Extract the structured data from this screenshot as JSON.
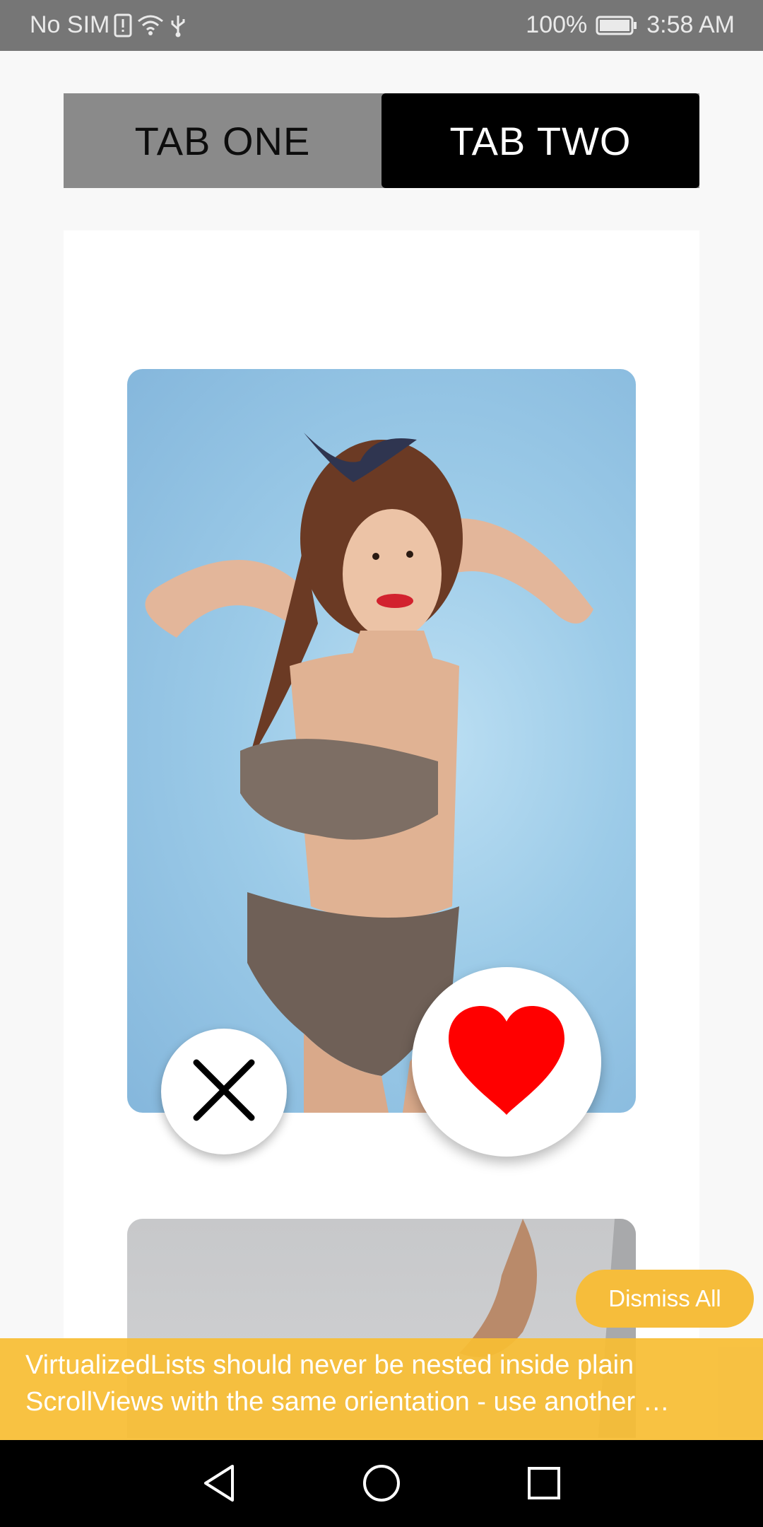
{
  "status_bar": {
    "carrier": "No SIM",
    "battery": "100%",
    "time": "3:58 AM",
    "icons": [
      "sim-alert-icon",
      "wifi-icon",
      "usb-icon",
      "battery-icon"
    ]
  },
  "tabs": [
    {
      "label": "TAB ONE",
      "selected": false
    },
    {
      "label": "TAB TWO",
      "selected": true
    }
  ],
  "card": {
    "dislike_icon": "close-icon",
    "like_icon": "heart-icon",
    "like_color": "#ff0000"
  },
  "warning": {
    "dismiss_label": "Dismiss All",
    "line1": "VirtualizedLists should never be nested inside plain",
    "line2": "ScrollViews with the same orientation - use another …"
  },
  "nav_bar": {
    "icons": [
      "back-icon",
      "home-icon",
      "recents-icon"
    ]
  },
  "colors": {
    "status_bar": "#767676",
    "tab_selected_bg": "#000000",
    "tab_bar_bg": "#8a8a8a",
    "warning": "#f6bd3b"
  }
}
